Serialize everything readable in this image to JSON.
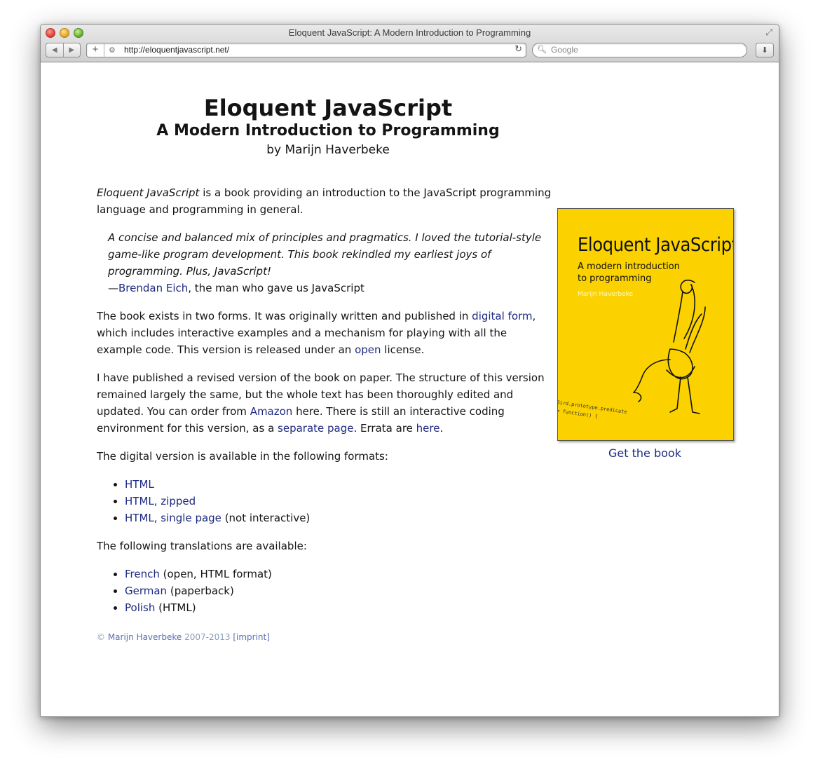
{
  "browser": {
    "window_title": "Eloquent JavaScript: A Modern Introduction to Programming",
    "url": "http://eloquentjavascript.net/",
    "search_placeholder": "Google",
    "new_tab_label": "+",
    "back_icon": "◀",
    "forward_icon": "▶"
  },
  "header": {
    "title": "Eloquent JavaScript",
    "subtitle": "A Modern Introduction to Programming",
    "author_line": "by Marijn Haverbeke"
  },
  "intro": {
    "book_name": "Eloquent JavaScript",
    "rest": " is a book providing an introduction to the JavaScript programming language and programming in general."
  },
  "quote": {
    "text": "A concise and balanced mix of principles and pragmatics. I loved the tutorial-style game-like program development. This book rekindled my earliest joys of programming. Plus, JavaScript!",
    "dash": "—",
    "author_link": "Brendan Eich",
    "author_suffix": ", the man who gave us JavaScript"
  },
  "forms_para": {
    "t1": "The book exists in two forms. It was originally written and published in ",
    "link1": "digital form",
    "t2": ", which includes interactive examples and a mechanism for playing with all the example code. This version is released under an ",
    "link2": "open",
    "t3": " license."
  },
  "paper_para": {
    "t1": "I have published a revised version of the book on paper. The structure of this version remained largely the same, but the whole text has been thoroughly edited and updated. You can order from ",
    "link1": "Amazon",
    "t2": " here. There is still an interactive coding environment for this version, as a ",
    "link2": "separate page",
    "t3": ". Errata are ",
    "link3": "here",
    "t4": "."
  },
  "formats": {
    "intro": "The digital version is available in the following formats:",
    "items": [
      {
        "link": "HTML",
        "suffix": ""
      },
      {
        "link": "HTML, zipped",
        "suffix": ""
      },
      {
        "link": "HTML, single page",
        "suffix": " (not interactive)"
      }
    ]
  },
  "translations": {
    "intro": "The following translations are available:",
    "items": [
      {
        "link": "French",
        "suffix": " (open, HTML format)"
      },
      {
        "link": "German",
        "suffix": " (paperback)"
      },
      {
        "link": "Polish",
        "suffix": " (HTML)"
      }
    ]
  },
  "footer": {
    "copyright": "© ",
    "author_link": "Marijn Haverbeke",
    "years": " 2007-2013 ",
    "imprint_link": "[imprint]"
  },
  "cover": {
    "title": "Eloquent JavaScript",
    "subtitle": "A modern introduction to programming",
    "author": "Marijn Haverbeke",
    "code_line1": "Bird.prototype.predicate",
    "code_line2": "= function() {",
    "bg_color": "#fbd200"
  },
  "get_book": "Get the book",
  "colors": {
    "link": "#1d2a80",
    "footer_text": "#8a9bb5"
  }
}
